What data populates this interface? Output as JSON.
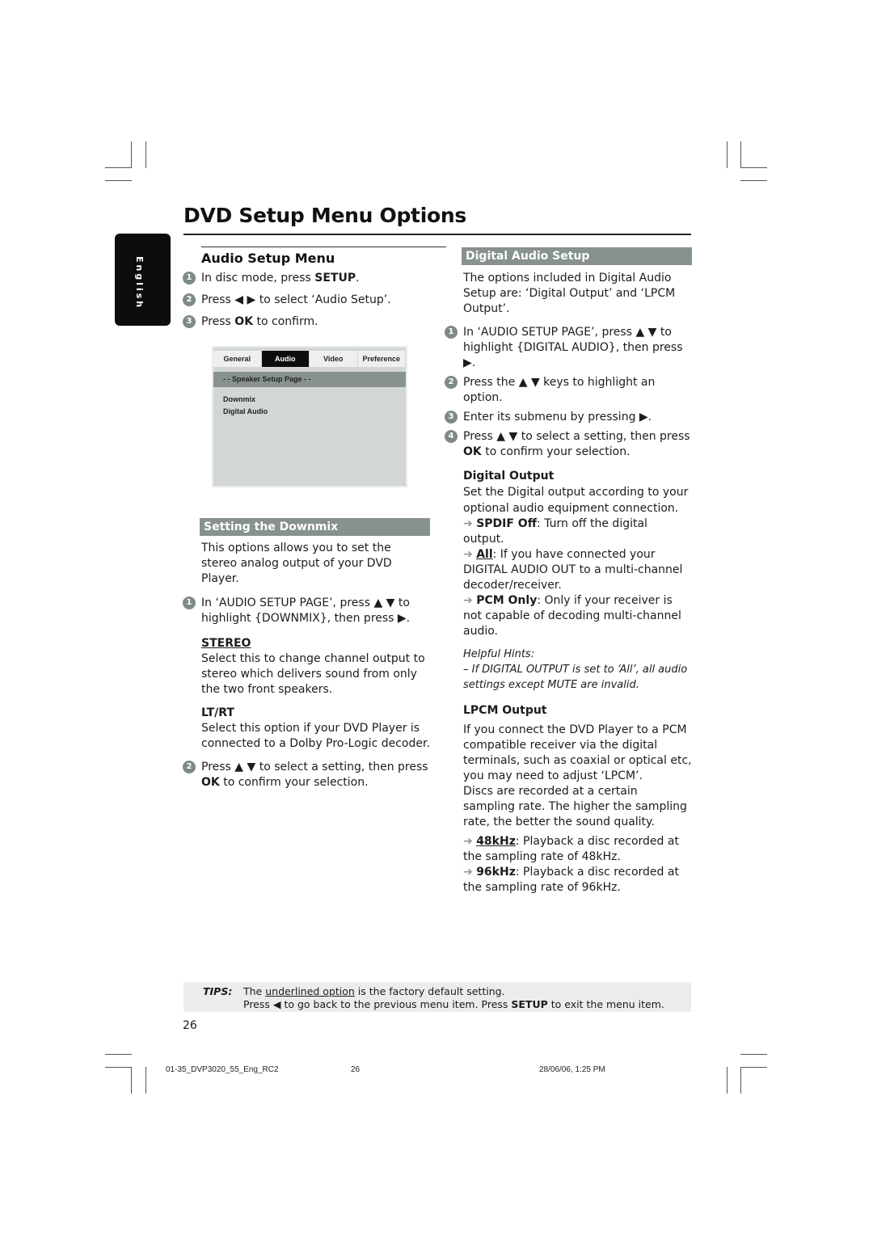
{
  "page": {
    "title": "DVD Setup Menu Options",
    "language_tab": "English",
    "page_number": "26"
  },
  "left": {
    "heading": "Audio Setup Menu",
    "steps": [
      {
        "num": "1",
        "pre": "In disc mode, press ",
        "bold": "SETUP",
        "post": "."
      },
      {
        "num": "2",
        "pre": "Press ◀ ▶ to select ‘Audio Setup’.",
        "bold": "",
        "post": ""
      },
      {
        "num": "3",
        "pre": "Press ",
        "bold": "OK",
        "post": " to confirm."
      }
    ],
    "osd": {
      "tabs": [
        "General",
        "Audio",
        "Video",
        "Preference"
      ],
      "active_tab": "Audio",
      "page_label": "- -  Speaker Setup Page  - -",
      "items": [
        "Downmix",
        "Digital Audio"
      ]
    },
    "downmix": {
      "bar": "Setting the Downmix",
      "intro": "This options allows you to set the stereo analog output of your DVD Player.",
      "step1_num": "1",
      "step1": "In ‘AUDIO SETUP PAGE’, press ▲ ▼ to highlight {DOWNMIX}, then press ▶.",
      "stereo_head": "STEREO",
      "stereo_text": "Select this to change channel output to stereo which delivers sound from only the two front speakers.",
      "ltrt_head": "LT/RT",
      "ltrt_text": "Select this option if your DVD Player is connected to a Dolby Pro-Logic decoder.",
      "step2_num": "2",
      "step2_pre": "Press ▲ ▼ to select a setting, then press ",
      "step2_bold": "OK",
      "step2_post": " to confirm your selection."
    }
  },
  "right": {
    "bar": "Digital Audio Setup",
    "intro": "The options included in Digital Audio Setup are: ‘Digital Output’ and ‘LPCM Output’.",
    "steps": [
      {
        "num": "1",
        "text": "In ‘AUDIO SETUP PAGE’, press ▲ ▼ to highlight {DIGITAL AUDIO}, then press ▶."
      },
      {
        "num": "2",
        "text": "Press the ▲ ▼ keys to highlight an option."
      },
      {
        "num": "3",
        "text": "Enter its submenu by pressing ▶."
      }
    ],
    "step4_num": "4",
    "step4_pre": "Press ▲ ▼ to select a setting, then press ",
    "step4_bold": "OK",
    "step4_post": " to confirm your selection.",
    "digital_output": {
      "head": "Digital Output",
      "text": "Set the Digital output according to your optional audio equipment connection.",
      "options": [
        {
          "label": "SPDIF Off",
          "desc": ": Turn off the digital output.",
          "default": false
        },
        {
          "label": "All",
          "desc": ": If you have connected your DIGITAL AUDIO OUT to a multi-channel decoder/receiver.",
          "default": true
        },
        {
          "label": "PCM Only",
          "desc": ": Only if your receiver is not capable of decoding multi-channel audio.",
          "default": false
        }
      ]
    },
    "hints": {
      "title": "Helpful Hints:",
      "text": "–    If DIGITAL OUTPUT is set to ‘All’, all audio settings except MUTE are invalid."
    },
    "lpcm": {
      "head": "LPCM Output",
      "text1": "If you connect the DVD Player to a PCM compatible receiver via the digital terminals, such as coaxial or optical etc, you may need to adjust ‘LPCM’.",
      "text2": "Discs are recorded at a certain sampling rate. The higher the sampling rate, the better the sound quality.",
      "options": [
        {
          "label": "48kHz",
          "desc": ": Playback a disc recorded at the sampling rate of 48kHz.",
          "default": true
        },
        {
          "label": "96kHz",
          "desc": ": Playback a disc recorded at the sampling rate of 96kHz.",
          "default": false
        }
      ]
    }
  },
  "tips": {
    "label": "TIPS:",
    "line1_pre": "The ",
    "line1_u": "underlined option",
    "line1_post": " is the factory default setting.",
    "line2_pre": "Press ◀ to go back to the previous menu item. Press ",
    "line2_bold": "SETUP",
    "line2_post": " to exit the menu item."
  },
  "footer": {
    "file": "01-35_DVP3020_55_Eng_RC2",
    "page": "26",
    "date": "28/06/06, 1:25 PM"
  },
  "arrow_glyph": "➔"
}
